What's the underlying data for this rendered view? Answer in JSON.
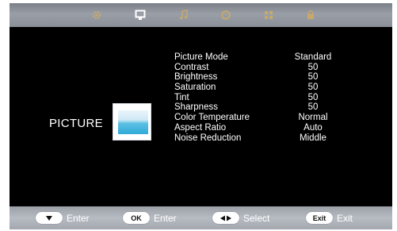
{
  "tabs": [
    {
      "icon": "gear-icon",
      "active": false
    },
    {
      "icon": "monitor-icon",
      "active": true
    },
    {
      "icon": "music-note-icon",
      "active": false
    },
    {
      "icon": "clock-icon",
      "active": false
    },
    {
      "icon": "grid-icon",
      "active": false
    },
    {
      "icon": "lock-icon",
      "active": false
    }
  ],
  "section": {
    "label": "PICTURE",
    "icon": "picture-thumbnail-icon"
  },
  "menu": {
    "items": [
      {
        "label": "Picture Mode",
        "value": "Standard"
      },
      {
        "label": "Contrast",
        "value": "50"
      },
      {
        "label": "Brightness",
        "value": "50"
      },
      {
        "label": "Saturation",
        "value": "50"
      },
      {
        "label": "Tint",
        "value": "50"
      },
      {
        "label": "Sharpness",
        "value": "50"
      },
      {
        "label": "Color Temperature",
        "value": "Normal"
      },
      {
        "label": "Aspect Ratio",
        "value": "Auto"
      },
      {
        "label": "Noise Reduction",
        "value": "Middle"
      }
    ]
  },
  "hints": [
    {
      "key": "down-arrow-key-icon",
      "action": "Enter"
    },
    {
      "key": "OK",
      "action": "Enter"
    },
    {
      "key": "left-right-arrow-key-icon",
      "action": "Select"
    },
    {
      "key": "Exit",
      "action": "Exit"
    }
  ],
  "colors": {
    "background": "#000000",
    "tabbar": "#9a9fa7",
    "active_tab_icon": "#ffffff",
    "inactive_tab_icon": "#c8a96a",
    "text": "#ffffff"
  }
}
